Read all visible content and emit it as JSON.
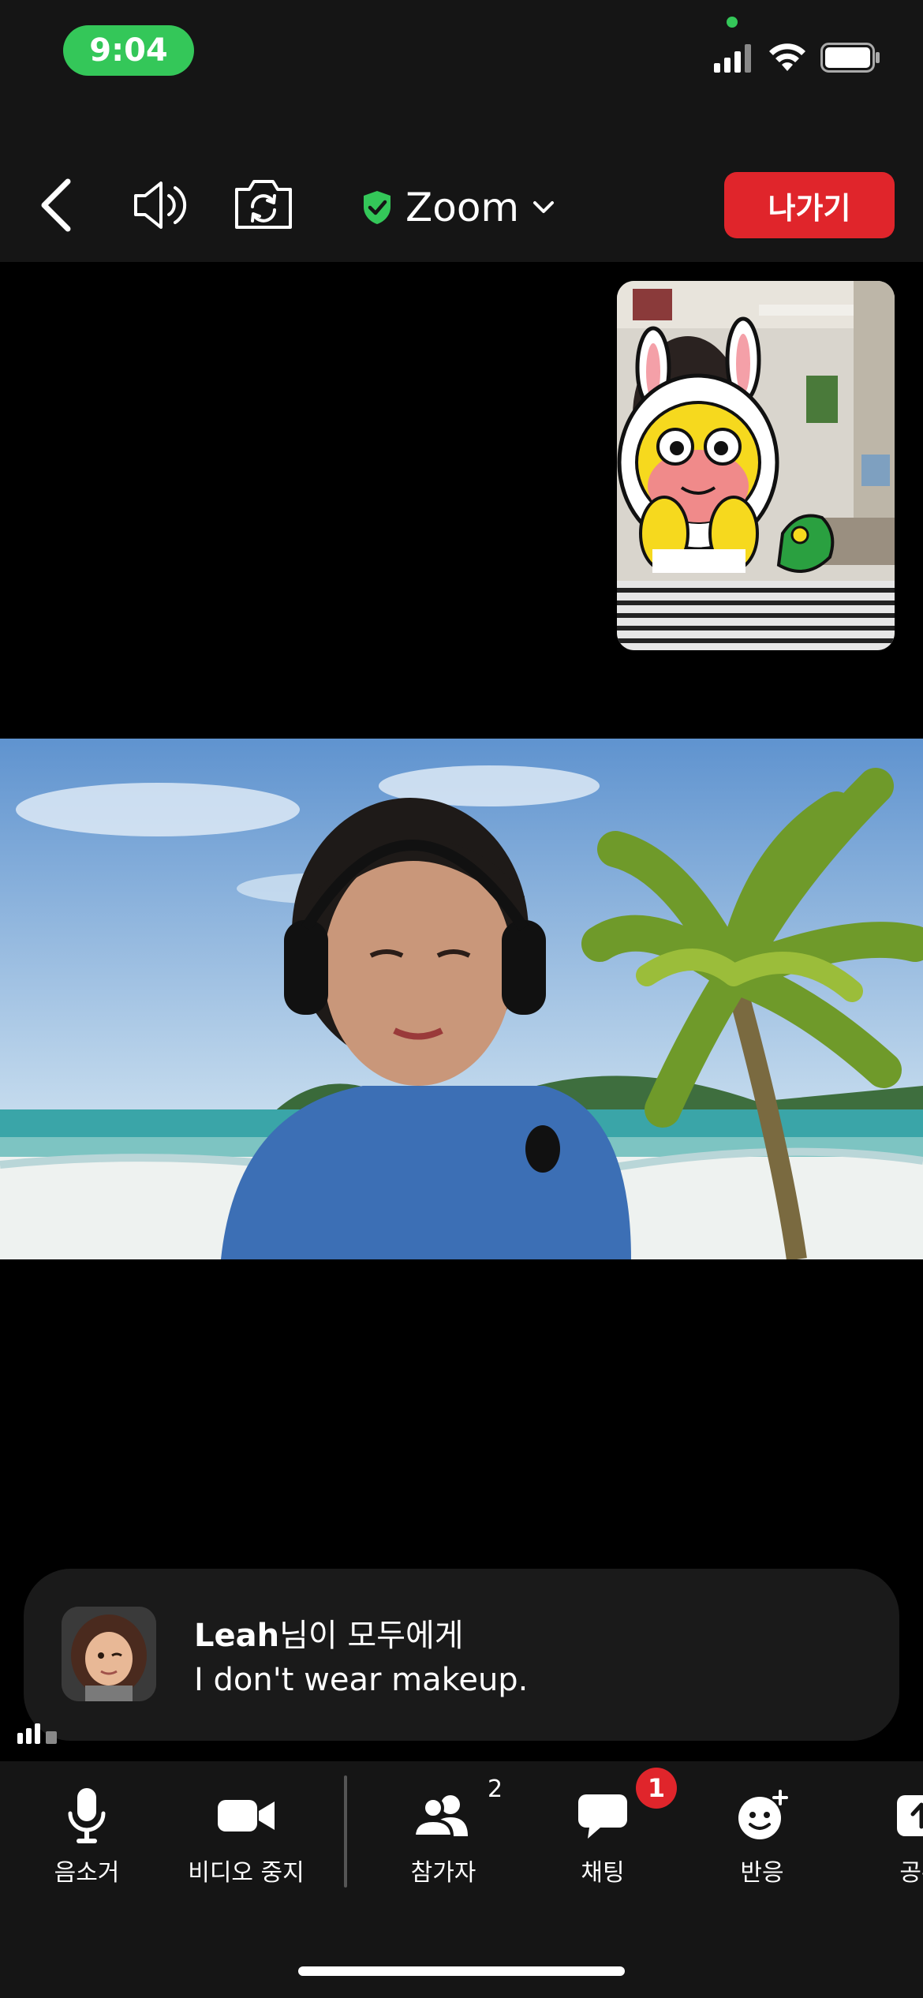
{
  "status_bar": {
    "time": "9:04"
  },
  "toolbar": {
    "meeting_title": "Zoom",
    "leave_label": "나가기"
  },
  "chat_toast": {
    "sender_name": "Leah",
    "sender_suffix": "님이 모두에게",
    "message": "I don't wear makeup."
  },
  "bottom_bar": {
    "mute_label": "음소거",
    "stop_video_label": "비디오 중지",
    "participants_label": "참가자",
    "participants_count": "2",
    "chat_label": "채팅",
    "chat_unread": "1",
    "reactions_label": "반응",
    "share_label": "공유"
  },
  "colors": {
    "accent_green": "#34c759",
    "leave_red": "#e0252b",
    "bar_background": "#151515"
  },
  "icons": [
    "back-icon",
    "speaker-icon",
    "camera-switch-icon",
    "shield-check-icon",
    "chevron-down-icon",
    "microphone-icon",
    "video-camera-icon",
    "participants-icon",
    "chat-bubble-icon",
    "reaction-smiley-icon",
    "share-icon"
  ]
}
